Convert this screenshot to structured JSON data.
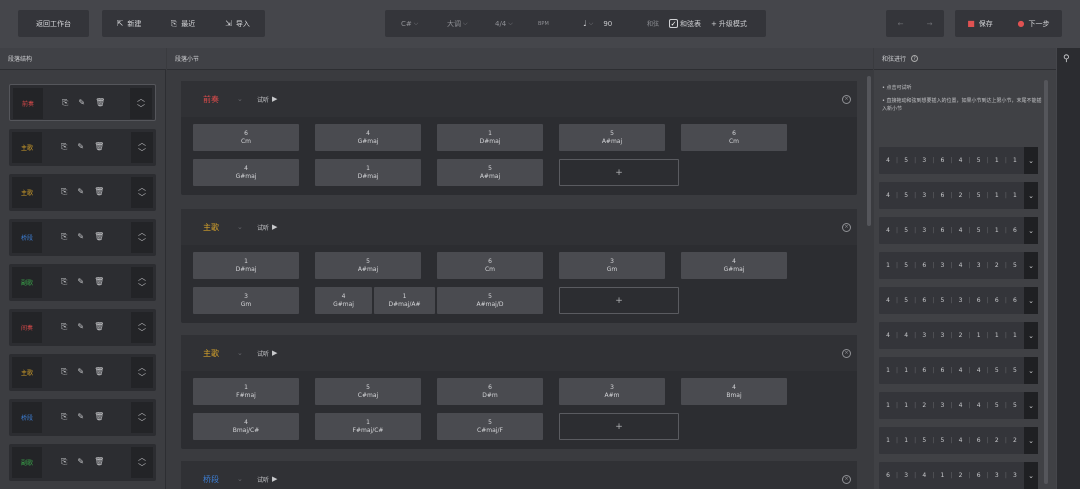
{
  "topbar": {
    "back_label": "返回工作台",
    "new_label": "新建",
    "recent_label": "最近",
    "import_label": "导入",
    "key": "C#",
    "mode": "大调",
    "meter": "4/4",
    "tempo_label": "BPM",
    "tempo": "90",
    "chord_label": "和弦",
    "chord_check_label": "和弦表",
    "upgrade_label": "升级模式",
    "save_label": "保存",
    "next_label": "下一步"
  },
  "headers": {
    "left": "段落结构",
    "middle": "段落小节",
    "right": "和弦进行"
  },
  "left_sections": [
    {
      "name": "前奏",
      "color": "#d84a4a"
    },
    {
      "name": "主歌",
      "color": "#d4a12a"
    },
    {
      "name": "主歌",
      "color": "#d4a12a"
    },
    {
      "name": "桥段",
      "color": "#3d7fd6"
    },
    {
      "name": "副歌",
      "color": "#3aa54a"
    },
    {
      "name": "间奏",
      "color": "#d84a4a"
    },
    {
      "name": "主歌",
      "color": "#d4a12a"
    },
    {
      "name": "桥段",
      "color": "#3d7fd6"
    },
    {
      "name": "副歌",
      "color": "#3aa54a"
    }
  ],
  "blocks": [
    {
      "name": "前奏",
      "color": "#d84a4a",
      "listen": "试听",
      "rows": [
        [
          {
            "n": "6",
            "c": "Cm"
          },
          {
            "n": "4",
            "c": "G#maj"
          },
          {
            "n": "1",
            "c": "D#maj"
          },
          {
            "n": "5",
            "c": "A#maj"
          },
          {
            "n": "6",
            "c": "Cm"
          }
        ],
        [
          {
            "n": "4",
            "c": "G#maj"
          },
          {
            "n": "1",
            "c": "D#maj"
          },
          {
            "n": "5",
            "c": "A#maj"
          }
        ]
      ]
    },
    {
      "name": "主歌",
      "color": "#d4a12a",
      "listen": "试听",
      "rows": [
        [
          {
            "n": "1",
            "c": "D#maj"
          },
          {
            "n": "5",
            "c": "A#maj"
          },
          {
            "n": "6",
            "c": "Cm"
          },
          {
            "n": "3",
            "c": "Gm"
          },
          {
            "n": "4",
            "c": "G#maj"
          }
        ],
        [
          {
            "n": "3",
            "c": "Gm"
          },
          {
            "n": "4",
            "c": "G#maj"
          },
          {
            "n": "1",
            "c": "D#maj/A#"
          },
          {
            "n": "5",
            "c": "A#maj/D"
          }
        ]
      ]
    },
    {
      "name": "主歌",
      "color": "#d4a12a",
      "listen": "试听",
      "rows": [
        [
          {
            "n": "1",
            "c": "F#maj"
          },
          {
            "n": "5",
            "c": "C#maj"
          },
          {
            "n": "6",
            "c": "D#m"
          },
          {
            "n": "3",
            "c": "A#m"
          },
          {
            "n": "4",
            "c": "Bmaj"
          }
        ],
        [
          {
            "n": "4",
            "c": "Bmaj/C#"
          },
          {
            "n": "1",
            "c": "F#maj/C#"
          },
          {
            "n": "5",
            "c": "C#maj/F"
          }
        ]
      ]
    },
    {
      "name": "桥段",
      "color": "#3d7fd6",
      "listen": "试听",
      "rows": []
    }
  ],
  "tips": [
    "• 点击可试听",
    "• 直接拖动和弦到想要插入的位置，如果小节到达上限小节，末尾不能插入新小节"
  ],
  "progressions": [
    [
      "4",
      "5",
      "3",
      "6",
      "4",
      "5",
      "1",
      "1"
    ],
    [
      "4",
      "5",
      "3",
      "6",
      "2",
      "5",
      "1",
      "1"
    ],
    [
      "4",
      "5",
      "3",
      "6",
      "4",
      "5",
      "1",
      "6"
    ],
    [
      "1",
      "5",
      "6",
      "3",
      "4",
      "3",
      "2",
      "5"
    ],
    [
      "4",
      "5",
      "6",
      "5",
      "3",
      "6",
      "6",
      "6"
    ],
    [
      "4",
      "4",
      "3",
      "3",
      "2",
      "1",
      "1",
      "1"
    ],
    [
      "1",
      "1",
      "6",
      "6",
      "4",
      "4",
      "5",
      "5"
    ],
    [
      "1",
      "1",
      "2",
      "3",
      "4",
      "4",
      "5",
      "5"
    ],
    [
      "1",
      "1",
      "5",
      "5",
      "4",
      "6",
      "2",
      "2"
    ],
    [
      "6",
      "3",
      "4",
      "1",
      "2",
      "6",
      "3",
      "3"
    ]
  ]
}
